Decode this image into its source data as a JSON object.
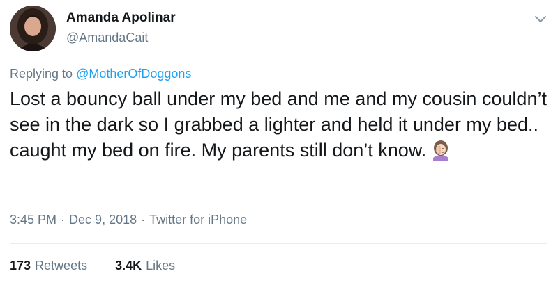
{
  "author": {
    "display_name": "Amanda Apolinar",
    "handle": "@AmandaCait",
    "avatar_icon": "profile-photo"
  },
  "reply": {
    "prefix": "Replying to",
    "mention": "@MotherOfDoggons"
  },
  "body": {
    "text": "Lost a bouncy ball under my bed and me and my cousin couldn’t see in the dark so I grabbed a lighter and held it under my bed.. caught my bed on fire. My parents still don’t know.",
    "emoji_icon": "face-palm-woman-emoji"
  },
  "meta": {
    "time": "3:45 PM",
    "date": "Dec 9, 2018",
    "source": "Twitter for iPhone",
    "separator": "·"
  },
  "stats": {
    "retweets_count": "173",
    "retweets_label": "Retweets",
    "likes_count": "3.4K",
    "likes_label": "Likes"
  },
  "colors": {
    "link": "#1da1f2",
    "secondary_text": "#657786",
    "primary_text": "#14171a"
  }
}
